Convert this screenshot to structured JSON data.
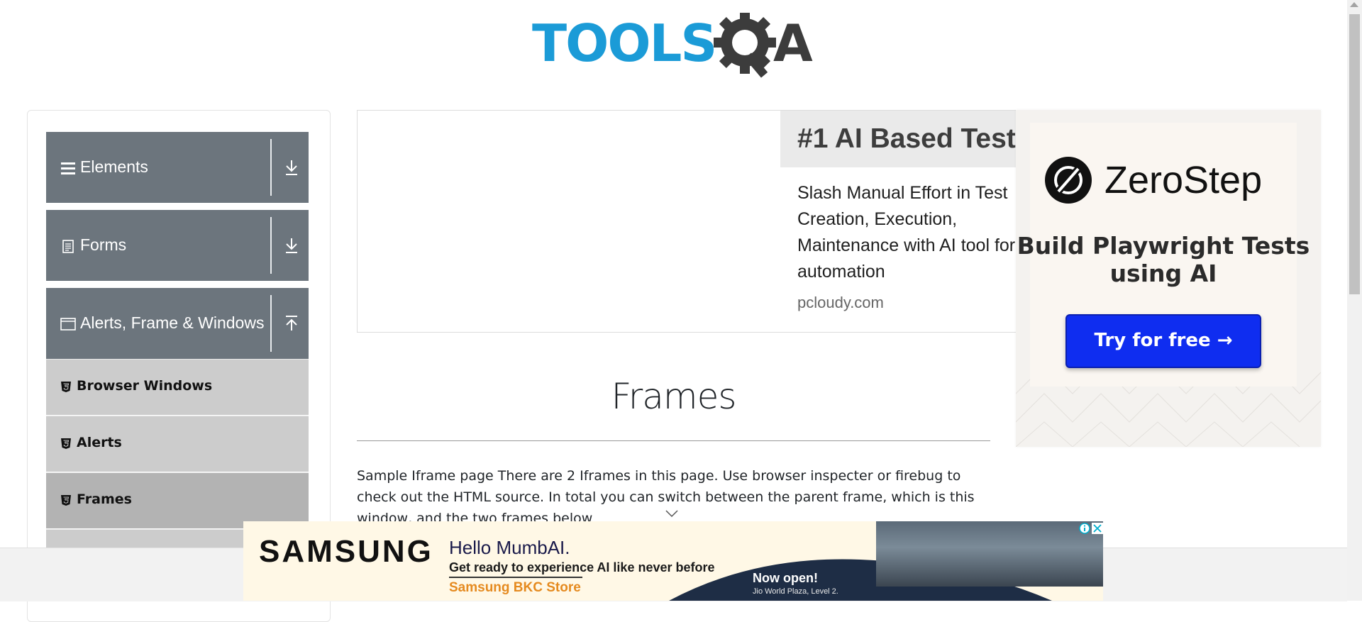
{
  "header": {
    "logo_text": "TOOLSQA"
  },
  "sidebar": {
    "groups": [
      {
        "title": "Elements",
        "icon": "hamburger-icon",
        "arrow": "download-arrow-icon"
      },
      {
        "title": "Forms",
        "icon": "document-icon",
        "arrow": "download-arrow-icon"
      },
      {
        "title": "Alerts, Frame & Windows",
        "icon": "window-icon",
        "arrow": "upload-arrow-icon"
      }
    ],
    "items": [
      {
        "label": "Browser Windows",
        "icon": "html5-icon",
        "active": false
      },
      {
        "label": "Alerts",
        "icon": "html5-icon",
        "active": false
      },
      {
        "label": "Frames",
        "icon": "html5-icon",
        "active": true
      }
    ]
  },
  "ads": {
    "pcloudy": {
      "title": "#1 AI Based Test",
      "body": "Slash Manual Effort in Test Creation, Execution, Maintenance with AI tool for automation",
      "domain": "pcloudy.com"
    },
    "zerostep": {
      "brand": "ZeroStep",
      "tagline": "Build Playwright Tests using AI",
      "cta": "Try for free →",
      "accent": "#0f2df0"
    },
    "samsung": {
      "brand": "SAMSUNG",
      "headline": "Hello MumbAI.",
      "subline": "Get ready to experience AI like never before",
      "store": "Samsung BKC Store",
      "open": "Now open!",
      "location": "Jio World Plaza, Level 2."
    }
  },
  "main": {
    "title": "Frames",
    "intro": "Sample Iframe page There are 2 Iframes in this page. Use browser inspecter or firebug to check out the HTML source. In total you can switch between the parent frame, which is this window, and the two frames below"
  },
  "colors": {
    "sidebar_group_bg": "#6c757d",
    "sidebar_item_bg": "#cccccc",
    "sidebar_item_active_bg": "#b3b3b3",
    "logo_blue": "#1b9bd7",
    "logo_dark": "#3c3c3c"
  }
}
